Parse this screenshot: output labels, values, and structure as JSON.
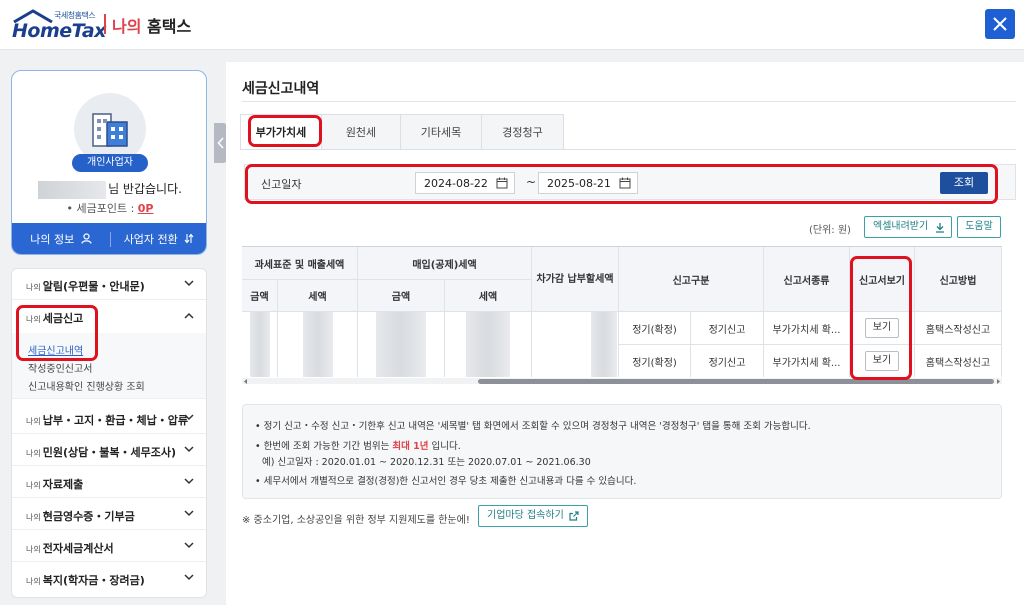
{
  "header": {
    "logo_small": "국세청홈택스",
    "logo_text": "HomeTax",
    "title_prefix": "나의",
    "title_suffix": "홈택스"
  },
  "profile": {
    "badge": "개인사업자",
    "greeting_suffix": "님 반갑습니다.",
    "points_label": "• 세금포인트 :",
    "points_value": "0P",
    "my_info": "나의 정보",
    "switch_biz": "사업자 전환"
  },
  "menu": {
    "items": [
      {
        "pre": "나의",
        "label": "알림(우편물・안내문)"
      },
      {
        "pre": "나의",
        "label": "세금신고"
      },
      {
        "pre": "나의",
        "label": "납부・고지・환급・체납・압류"
      },
      {
        "pre": "나의",
        "label": "민원(상담・불복・세무조사)"
      },
      {
        "pre": "나의",
        "label": "자료제출"
      },
      {
        "pre": "나의",
        "label": "현금영수증・기부금"
      },
      {
        "pre": "나의",
        "label": "전자세금계산서"
      },
      {
        "pre": "나의",
        "label": "복지(학자금・장려금)"
      }
    ],
    "sub_items": [
      "세금신고내역",
      "작성중인신고서",
      "신고내용확인 진행상황 조회"
    ]
  },
  "main": {
    "title": "세금신고내역",
    "tabs": [
      "부가가치세",
      "원천세",
      "기타세목",
      "경정청구"
    ],
    "search": {
      "label": "신고일자",
      "from": "2024-08-22",
      "tilde": "~",
      "to": "2025-08-21",
      "button": "조회"
    },
    "unit": "(단위: 원)",
    "excel": "엑셀내려받기",
    "help": "도움말"
  },
  "table": {
    "head": {
      "group1": "과세표준 및 매출세액",
      "group2": "매입(공제)세액",
      "amount": "금액",
      "tax": "세액",
      "diff": "차가감 납부할세액",
      "report_type": "신고구분",
      "form_type": "신고서종류",
      "view": "신고서보기",
      "method": "신고방법"
    },
    "rows": [
      {
        "type1": "정기(확정)",
        "type2": "정기신고",
        "form": "부가가치세 확...",
        "view": "보기",
        "method": "홈택스작성신고"
      },
      {
        "type1": "정기(확정)",
        "type2": "정기신고",
        "form": "부가가치세 확...",
        "view": "보기",
        "method": "홈택스작성신고"
      }
    ]
  },
  "notes": {
    "n1_a": "정기 신고・수정 신고・기한후 신고 내역은 '세목별' 탭 화면에서 조회할 수 있으며 경정청구 내역은 '경정청구' 탭을 통해 조회 가능합니다.",
    "n2_a": "한번에 조회 가능한 기간 범위는 ",
    "n2_red": "최대 1년",
    "n2_b": " 입니다.",
    "n3": "예) 신고일자 : 2020.01.01 ~ 2020.12.31 또는 2020.07.01 ~ 2021.06.30",
    "n4": "세무서에서 개별적으로 결정(경정)한 신고서인 경우 당초 제출한 신고내용과 다를 수 있습니다."
  },
  "footer": {
    "text": "※ 중소기업, 소상공인을 위한 정부 지원제도를 한눈에!",
    "button": "기업마당 접속하기"
  }
}
